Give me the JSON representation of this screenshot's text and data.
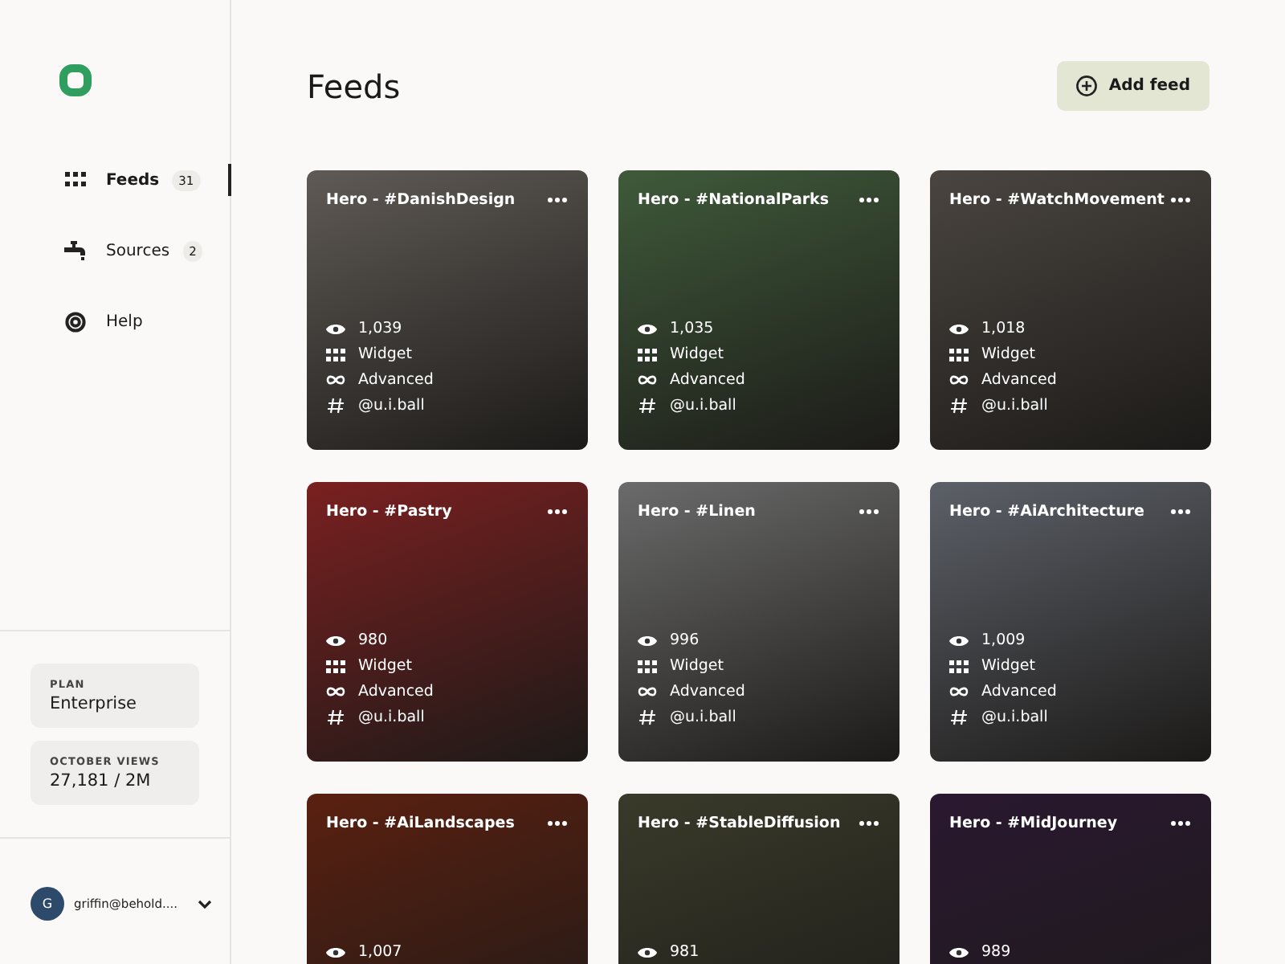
{
  "sidebar": {
    "nav": [
      {
        "kind": "grid",
        "label": "Feeds",
        "count": "31",
        "selected": true
      },
      {
        "kind": "tap",
        "label": "Sources",
        "count": "2",
        "selected": false
      },
      {
        "kind": "help",
        "label": "Help",
        "selected": false
      }
    ],
    "plan": {
      "label": "PLAN",
      "value": "Enterprise"
    },
    "views": {
      "label": "OCTOBER VIEWS",
      "value": "27,181 / 2M"
    },
    "user": {
      "initial": "G",
      "email": "griffin@behold...."
    }
  },
  "header": {
    "title": "Feeds",
    "add_button": "Add feed"
  },
  "feeds": [
    {
      "title": "Hero - #DanishDesign",
      "views": "1,039",
      "type": "Widget",
      "plan": "Advanced",
      "handle": "@u.i.ball"
    },
    {
      "title": "Hero - #NationalParks",
      "views": "1,035",
      "type": "Widget",
      "plan": "Advanced",
      "handle": "@u.i.ball"
    },
    {
      "title": "Hero - #WatchMovement",
      "views": "1,018",
      "type": "Widget",
      "plan": "Advanced",
      "handle": "@u.i.ball"
    },
    {
      "title": "Hero - #Pastry",
      "views": "980",
      "type": "Widget",
      "plan": "Advanced",
      "handle": "@u.i.ball"
    },
    {
      "title": "Hero - #Linen",
      "views": "996",
      "type": "Widget",
      "plan": "Advanced",
      "handle": "@u.i.ball"
    },
    {
      "title": "Hero - #AiArchitecture",
      "views": "1,009",
      "type": "Widget",
      "plan": "Advanced",
      "handle": "@u.i.ball"
    },
    {
      "title": "Hero - #AiLandscapes",
      "views": "1,007"
    },
    {
      "title": "Hero - #StableDiffusion",
      "views": "981"
    },
    {
      "title": "Hero - #MidJourney",
      "views": "989"
    }
  ]
}
